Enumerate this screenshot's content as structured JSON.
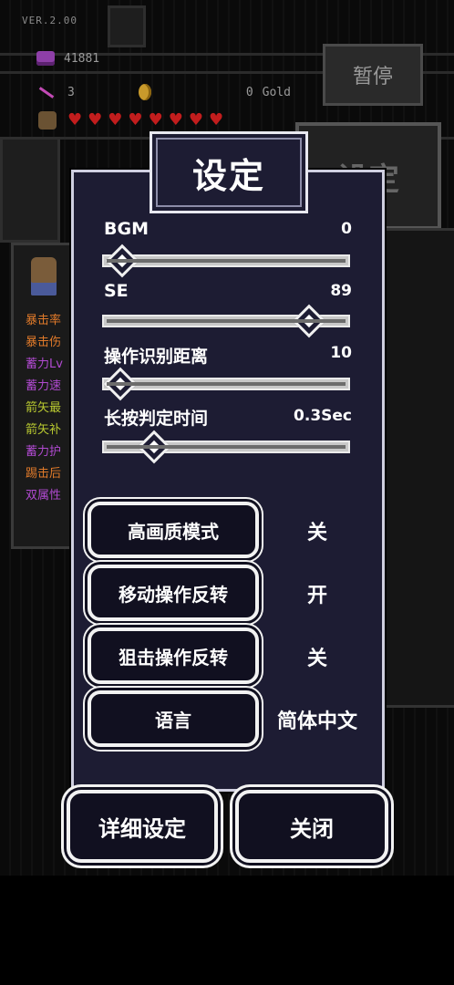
{
  "hud": {
    "version": "VER.2.00",
    "gems": "41881",
    "arrows": "3",
    "gold_amount": "0",
    "gold_label": "Gold",
    "hearts": 8,
    "pause_label": "暂停"
  },
  "background": {
    "settings_label": "设定",
    "stats": [
      {
        "label": "暴击率",
        "color": "#e07a2a"
      },
      {
        "label": "暴击伤",
        "color": "#e07a2a"
      },
      {
        "label": "蓄力Lv",
        "color": "#b04ad0"
      },
      {
        "label": "蓄力速",
        "color": "#b04ad0"
      },
      {
        "label": "箭矢最",
        "color": "#b8c830"
      },
      {
        "label": "箭矢补",
        "color": "#b8c830"
      },
      {
        "label": "蓄力护",
        "color": "#b04ad0"
      },
      {
        "label": "踢击后",
        "color": "#e07a2a"
      },
      {
        "label": "双属性",
        "color": "#b04ad0"
      }
    ]
  },
  "dialog": {
    "title": "设定",
    "sliders": [
      {
        "label": "BGM",
        "value": "0",
        "level": 0.03
      },
      {
        "label": "SE",
        "value": "89",
        "level": 0.86
      },
      {
        "label": "操作识别距离",
        "value": "10",
        "level": 0.02
      },
      {
        "label": "长按判定时间",
        "value": "0.3Sec",
        "level": 0.17
      }
    ],
    "options": [
      {
        "label": "高画质模式",
        "state": "关"
      },
      {
        "label": "移动操作反转",
        "state": "开"
      },
      {
        "label": "狙击操作反转",
        "state": "关"
      },
      {
        "label": "语言",
        "state": "简体中文"
      }
    ],
    "detail_button": "详细设定",
    "close_button": "关闭"
  }
}
